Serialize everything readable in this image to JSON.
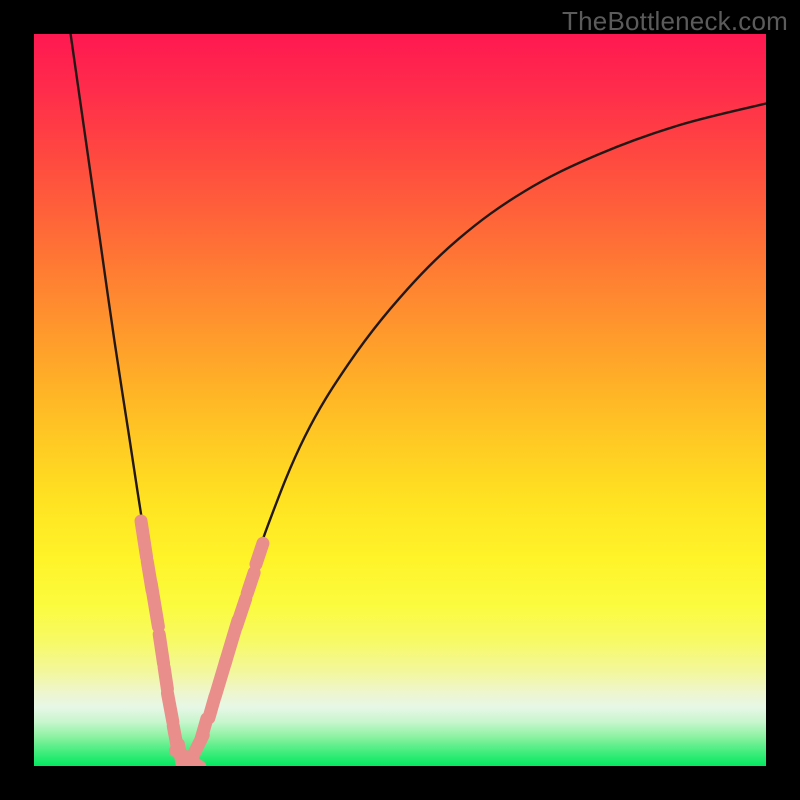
{
  "watermark": "TheBottleneck.com",
  "colors": {
    "frame": "#000000",
    "curve_stroke": "#231815",
    "marker_fill": "#e98e8a",
    "marker_stroke": "#e98e8a"
  },
  "chart_data": {
    "type": "line",
    "title": "",
    "xlabel": "",
    "ylabel": "",
    "xlim": [
      0,
      100
    ],
    "ylim": [
      0,
      100
    ],
    "grid": false,
    "notes": "V-shaped bottleneck curve. Y appears to be a mismatch/bottleneck percentage (0 at bottom = balanced, 100 at top = severe). X is an unlabeled component-performance axis. Minimum near x≈20. No tick labels shown; values estimated from curve shape.",
    "series": [
      {
        "name": "bottleneck-curve",
        "x": [
          5,
          7,
          9,
          11,
          13,
          15,
          17,
          18.5,
          20,
          21.5,
          23,
          25,
          28,
          32,
          37,
          43,
          50,
          58,
          67,
          77,
          88,
          100
        ],
        "y": [
          100,
          86,
          72,
          58,
          45,
          32,
          20,
          10,
          2,
          1,
          4,
          11,
          21,
          33,
          45,
          55,
          64,
          72,
          78.5,
          83.5,
          87.5,
          90.5
        ]
      }
    ],
    "markers": {
      "name": "highlighted-points",
      "note": "Pink capsule-shaped markers clustered near the valley of the curve, on both branches.",
      "points": [
        {
          "x": 15.0,
          "y": 31,
          "len": 5
        },
        {
          "x": 15.8,
          "y": 26,
          "len": 4
        },
        {
          "x": 16.5,
          "y": 22,
          "len": 6
        },
        {
          "x": 17.4,
          "y": 16,
          "len": 4
        },
        {
          "x": 18.0,
          "y": 12,
          "len": 3
        },
        {
          "x": 18.6,
          "y": 8,
          "len": 4
        },
        {
          "x": 19.3,
          "y": 4,
          "len": 3
        },
        {
          "x": 20.0,
          "y": 1.5,
          "len": 3
        },
        {
          "x": 21.0,
          "y": 1,
          "len": 4
        },
        {
          "x": 22.0,
          "y": 2,
          "len": 5
        },
        {
          "x": 23.2,
          "y": 5,
          "len": 3
        },
        {
          "x": 24.3,
          "y": 8,
          "len": 3
        },
        {
          "x": 25.5,
          "y": 12,
          "len": 5
        },
        {
          "x": 27.0,
          "y": 17,
          "len": 6
        },
        {
          "x": 28.3,
          "y": 21,
          "len": 4
        },
        {
          "x": 29.6,
          "y": 25,
          "len": 3
        },
        {
          "x": 30.8,
          "y": 29,
          "len": 3
        }
      ]
    }
  }
}
